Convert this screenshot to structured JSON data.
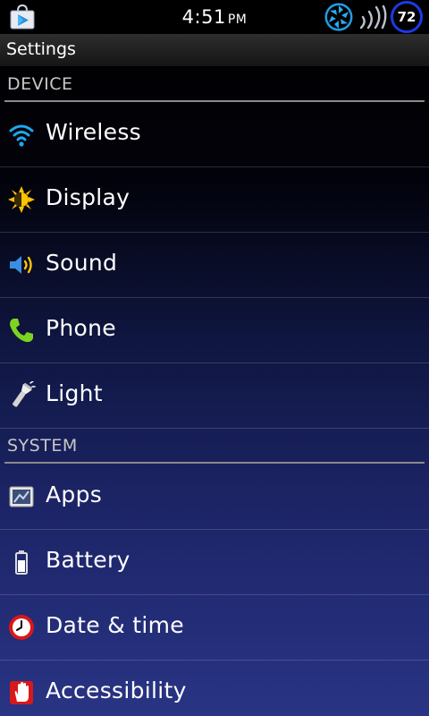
{
  "status_bar": {
    "time": "4:51",
    "ampm": "PM",
    "battery_level": "72",
    "icons": [
      "play-store-icon",
      "aperture-icon",
      "signal-waves-icon",
      "battery-circle-icon"
    ]
  },
  "title_bar": {
    "title": "Settings"
  },
  "sections": [
    {
      "header": "DEVICE",
      "items": [
        {
          "label": "Wireless",
          "icon": "wifi-icon"
        },
        {
          "label": "Display",
          "icon": "display-sun-icon"
        },
        {
          "label": "Sound",
          "icon": "speaker-icon"
        },
        {
          "label": "Phone",
          "icon": "phone-icon"
        },
        {
          "label": "Light",
          "icon": "flashlight-icon"
        }
      ]
    },
    {
      "header": "SYSTEM",
      "items": [
        {
          "label": "Apps",
          "icon": "apps-icon"
        },
        {
          "label": "Battery",
          "icon": "battery-icon"
        },
        {
          "label": "Date & time",
          "icon": "clock-icon"
        },
        {
          "label": "Accessibility",
          "icon": "hand-icon"
        }
      ]
    }
  ],
  "colors": {
    "battery_ring": "#1a3be8",
    "wifi_blue": "#1fa8f0",
    "phone_green": "#7ed321",
    "sun_yellow": "#ffc400",
    "clock_red": "#d8181a"
  }
}
